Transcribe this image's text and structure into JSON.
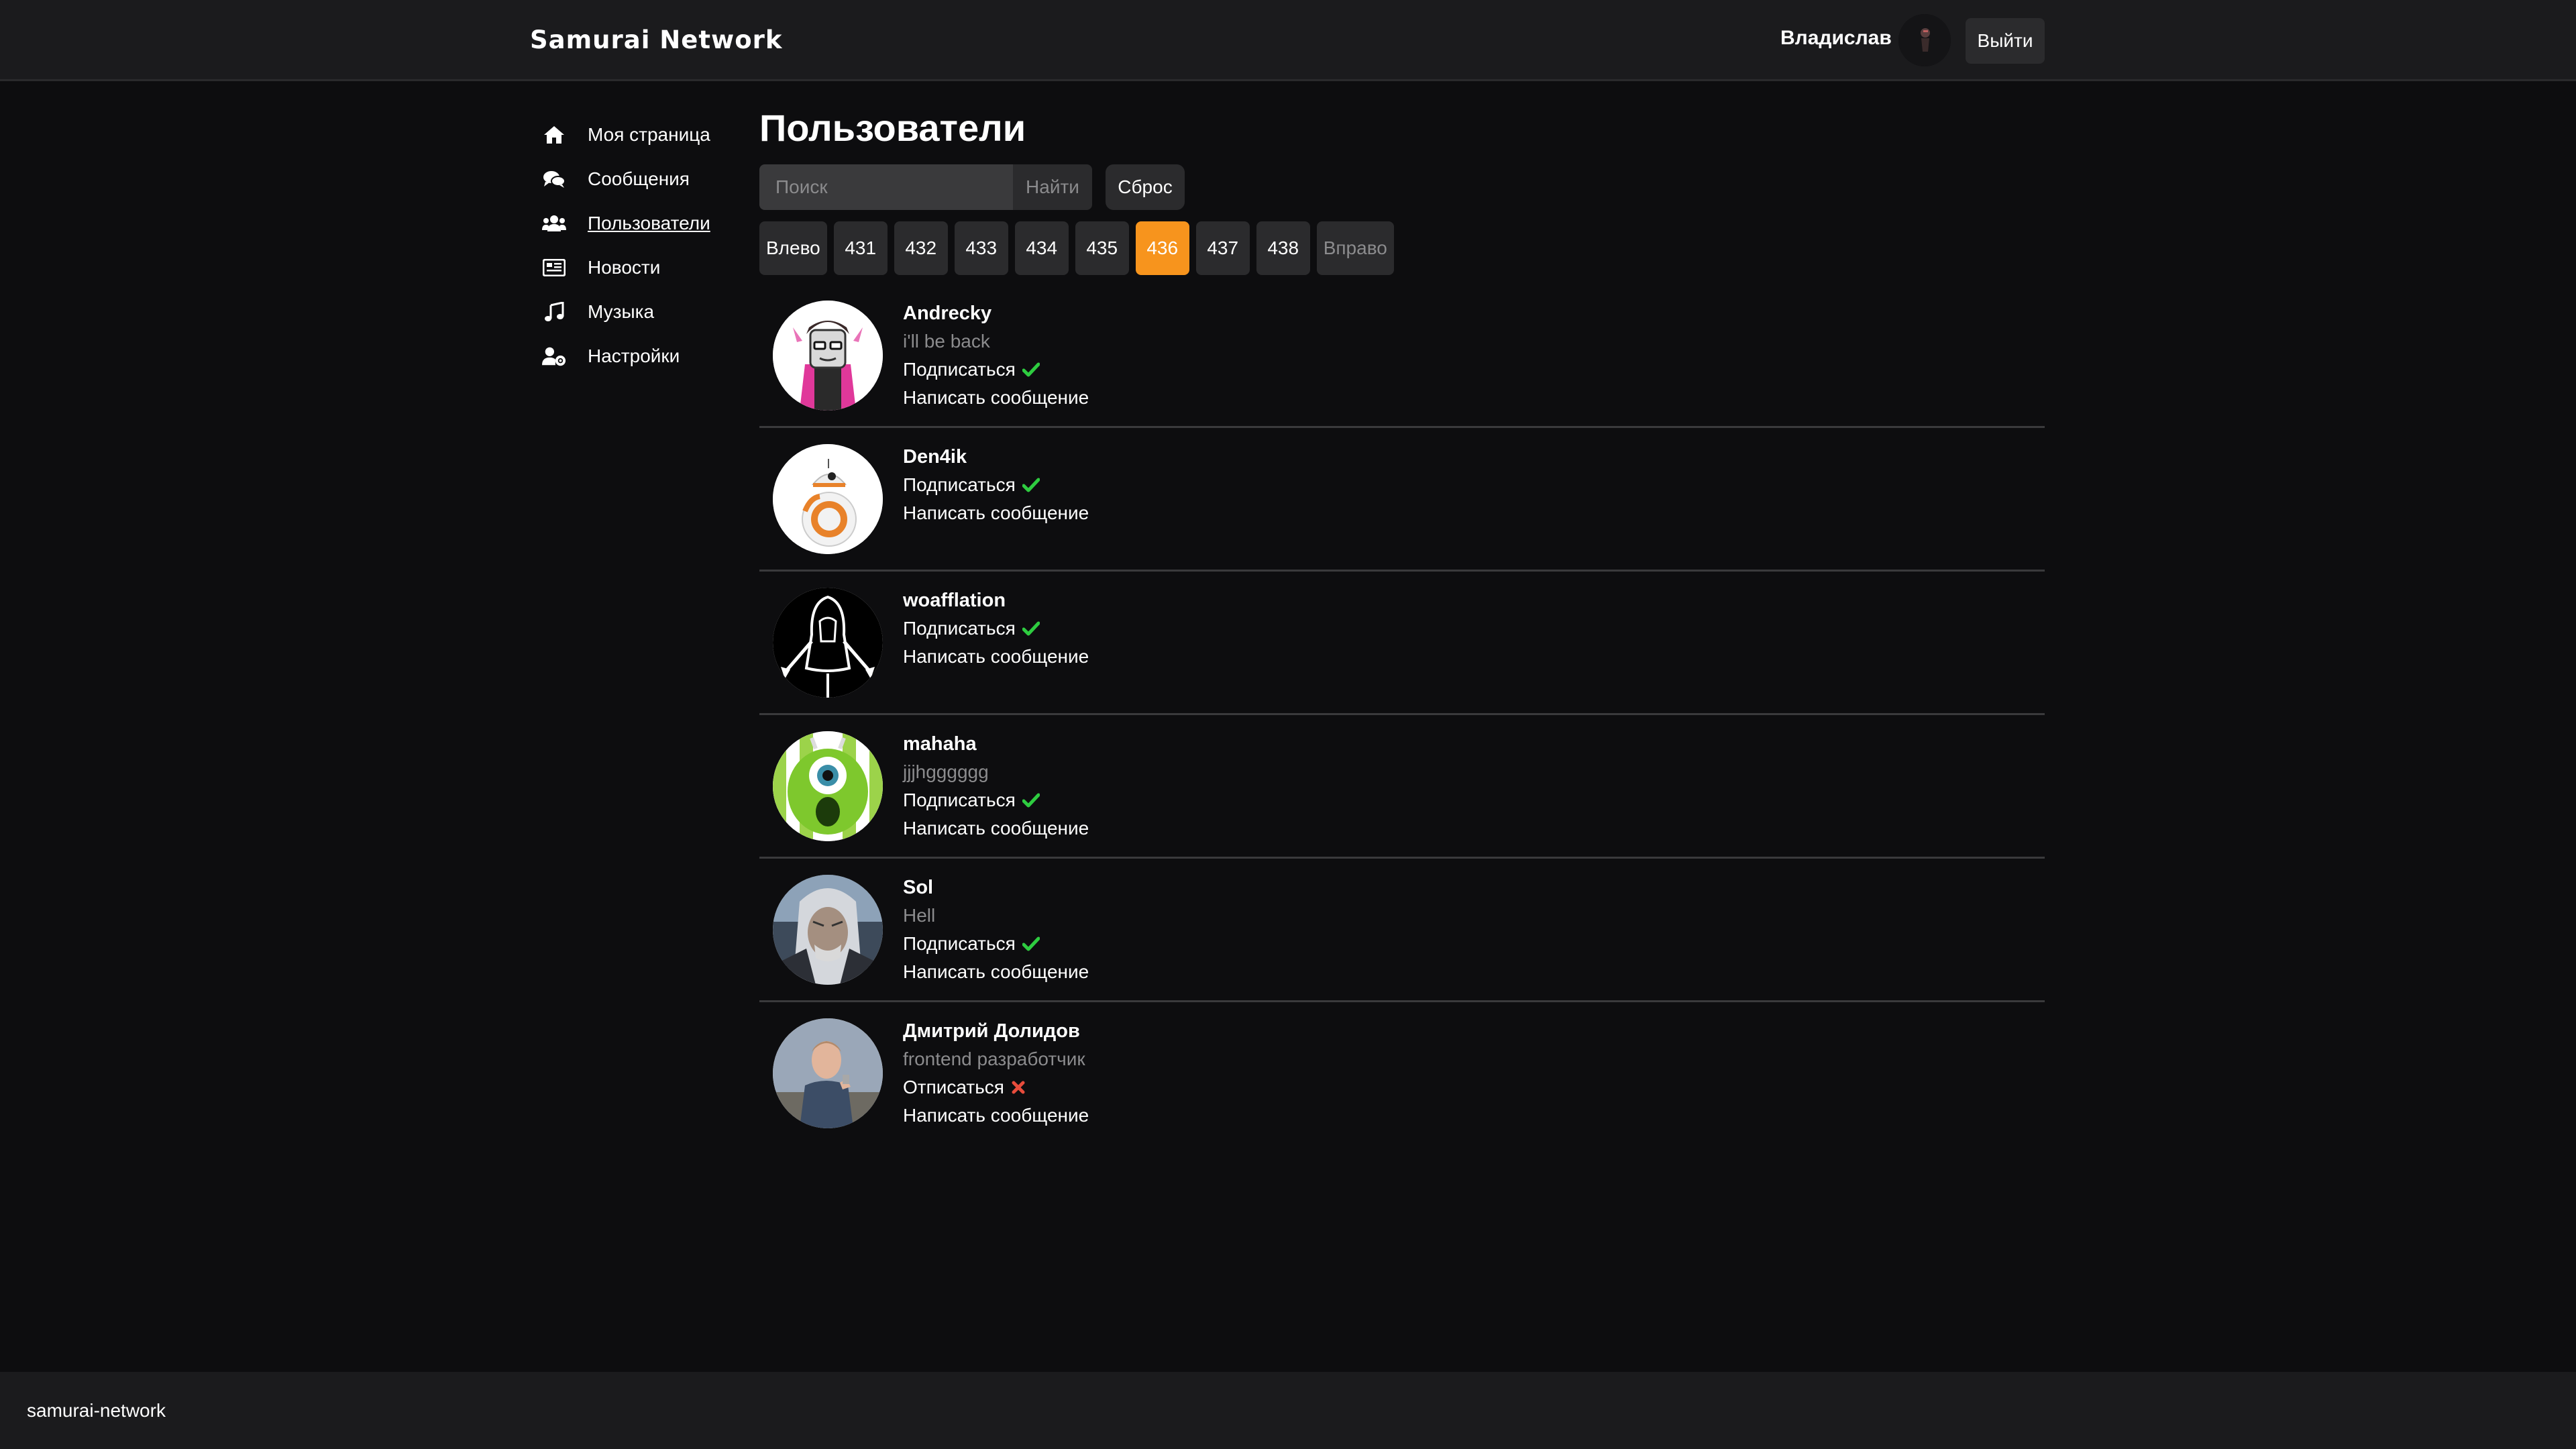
{
  "header": {
    "logo": "Samurai Network",
    "user_name": "Владислав",
    "logout_label": "Выйти"
  },
  "sidebar": {
    "items": [
      {
        "label": "Моя страница",
        "icon": "home-icon"
      },
      {
        "label": "Сообщения",
        "icon": "chat-icon"
      },
      {
        "label": "Пользователи",
        "icon": "users-icon",
        "active": true
      },
      {
        "label": "Новости",
        "icon": "news-icon"
      },
      {
        "label": "Музыка",
        "icon": "music-icon"
      },
      {
        "label": "Настройки",
        "icon": "user-settings-icon"
      }
    ]
  },
  "main": {
    "title": "Пользователи",
    "search": {
      "placeholder": "Поиск",
      "value": "",
      "button_label": "Найти"
    },
    "reset_label": "Сброс",
    "pagination": {
      "prev_label": "Влево",
      "next_label": "Вправо",
      "pages": [
        "431",
        "432",
        "433",
        "434",
        "435",
        "436",
        "437",
        "438"
      ],
      "current": "436"
    },
    "users": [
      {
        "name": "Andrecky",
        "status": "i'll be back",
        "action": "Подписаться",
        "action_icon": "checkmark-icon",
        "message": "Написать сообщение"
      },
      {
        "name": "Den4ik",
        "status": "",
        "action": "Подписаться",
        "action_icon": "checkmark-icon",
        "message": "Написать сообщение"
      },
      {
        "name": "woafflation",
        "status": "",
        "action": "Подписаться",
        "action_icon": "checkmark-icon",
        "message": "Написать сообщение"
      },
      {
        "name": "mahaha",
        "status": "jjjhgggggg",
        "action": "Подписаться",
        "action_icon": "checkmark-icon",
        "message": "Написать сообщение"
      },
      {
        "name": "Sol",
        "status": "Hell",
        "action": "Подписаться",
        "action_icon": "checkmark-icon",
        "message": "Написать сообщение"
      },
      {
        "name": "Дмитрий Долидов",
        "status": "frontend разработчик",
        "action": "Отписаться",
        "action_icon": "cross-icon",
        "message": "Написать сообщение"
      }
    ]
  },
  "footer": {
    "text": "samurai-network"
  },
  "colors": {
    "accent": "#f7941d",
    "check": "#2ecc40",
    "cross": "#e74c3c",
    "background": "#0d0d0f",
    "panel": "#1b1b1d"
  }
}
